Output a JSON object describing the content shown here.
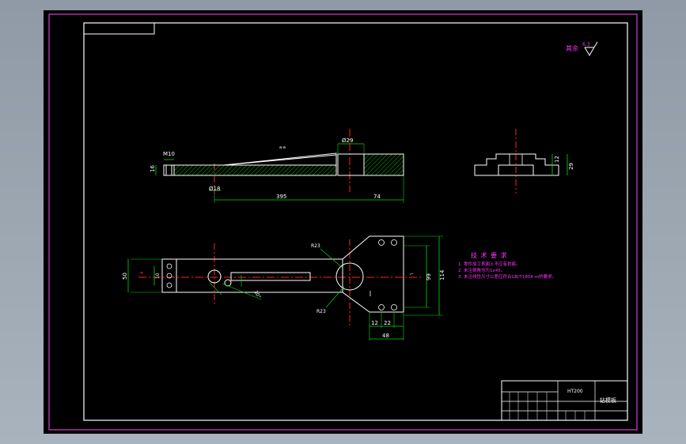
{
  "roughness": {
    "label": "其余",
    "value": "6.3"
  },
  "dims": {
    "m10": "M10",
    "d16": "16",
    "phi29": "Ø29",
    "phi18": "Ø18",
    "top_note": "a-a",
    "d395": "395",
    "d74": "74",
    "d12": "12",
    "d29": "29",
    "r23_top": "R23",
    "r23_bottom": "R23",
    "d50": "50",
    "d10": "10",
    "d99": "99",
    "d114": "114",
    "d12b": "12",
    "d22": "22",
    "d48": "48",
    "d10b": "10",
    "angle": "30°"
  },
  "tech": {
    "title": "技 术 要 求",
    "items": [
      "1. 零件加工表面上不应有划痕。",
      "2. 未注倒角均为1x45。",
      "3. 未注线性尺寸公差应符合GB/T1804-m的要求。"
    ]
  },
  "title_block": {
    "material": "HT200",
    "part_name": "钻模板"
  },
  "colors": {
    "background": "#000000",
    "frame": "#d43fd4",
    "outline": "#ffffff",
    "dimension": "#00e000",
    "centerline": "#ff2020",
    "hatch": "#00c000",
    "note": "#ff33ff"
  }
}
